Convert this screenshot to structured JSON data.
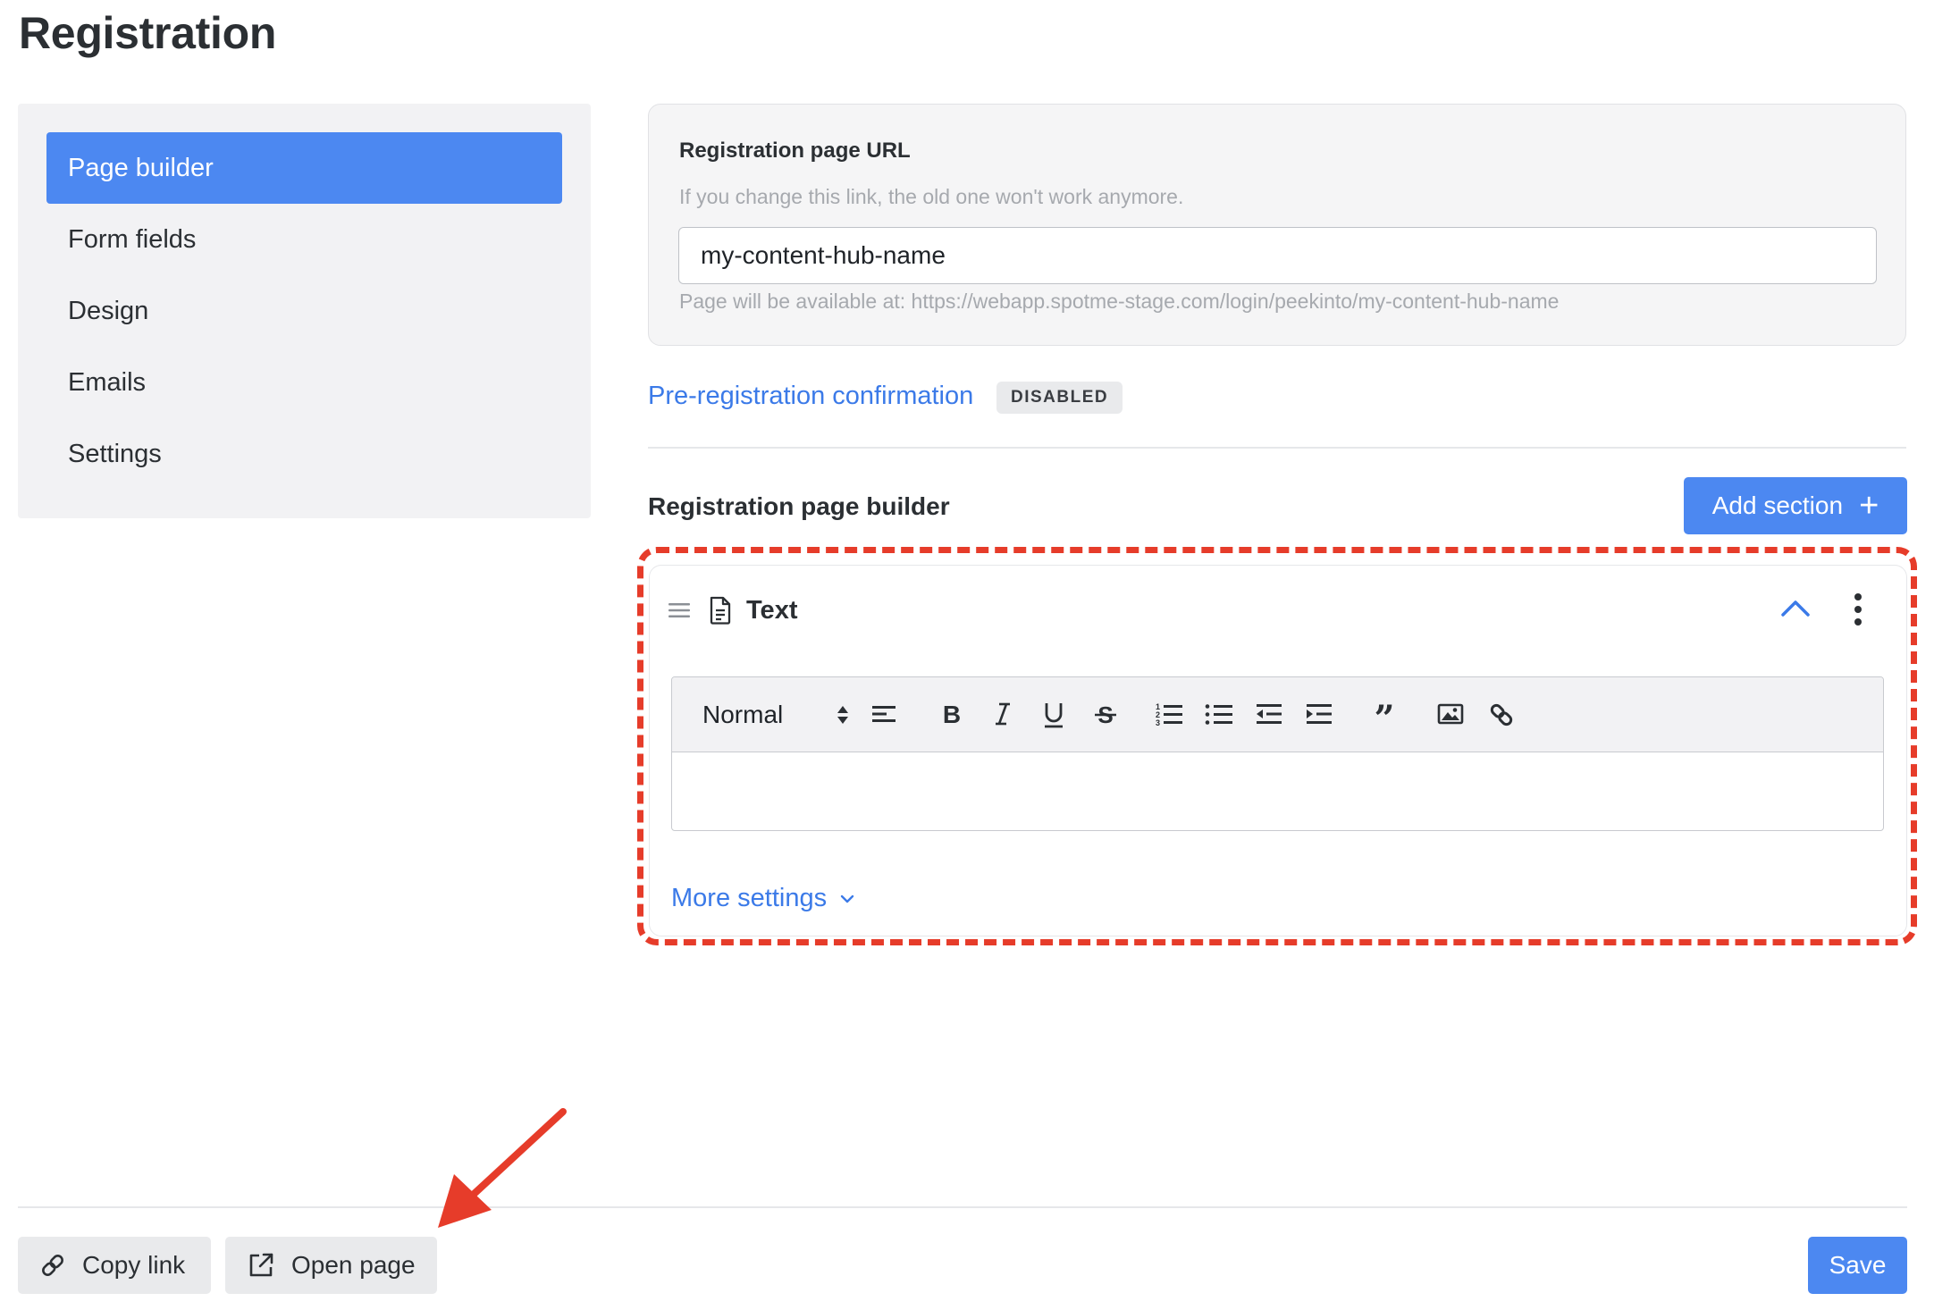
{
  "page": {
    "title": "Registration"
  },
  "sidebar": {
    "items": [
      {
        "label": "Page builder",
        "active": true
      },
      {
        "label": "Form fields",
        "active": false
      },
      {
        "label": "Design",
        "active": false
      },
      {
        "label": "Emails",
        "active": false
      },
      {
        "label": "Settings",
        "active": false
      }
    ]
  },
  "url_settings": {
    "label": "Registration page URL",
    "hint": "If you change this link, the old one won't work anymore.",
    "value": "my-content-hub-name",
    "available_text": "Page will be available at: https://webapp.spotme-stage.com/login/peekinto/my-content-hub-name"
  },
  "pre_registration": {
    "link_label": "Pre-registration confirmation",
    "badge": "DISABLED"
  },
  "builder": {
    "title": "Registration page builder",
    "add_section_label": "Add section",
    "section": {
      "name": "Text",
      "toolbar": {
        "style_value": "Normal",
        "tools": [
          "align-left-icon",
          "bold-icon",
          "italic-icon",
          "underline-icon",
          "strikethrough-icon",
          "ordered-list-icon",
          "bullet-list-icon",
          "outdent-icon",
          "indent-icon",
          "blockquote-icon",
          "image-icon",
          "link-icon"
        ]
      },
      "more_settings_label": "More settings"
    }
  },
  "footer": {
    "copy_link_label": "Copy link",
    "open_page_label": "Open page",
    "save_label": "Save"
  },
  "colors": {
    "accent": "#4c88f1",
    "link": "#3b7ae8",
    "annotation": "#e63c2a"
  }
}
